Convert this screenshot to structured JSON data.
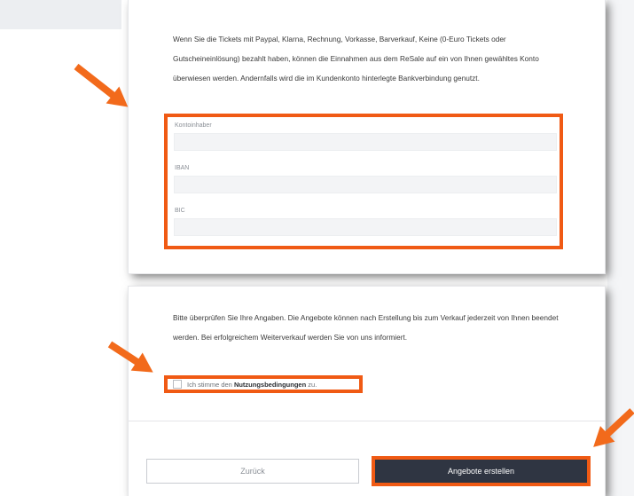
{
  "resale_info": {
    "text": "Wenn Sie die Tickets mit Paypal, Klarna, Rechnung, Vorkasse, Barverkauf, Keine (0-Euro Tickets oder Gutscheineinlösung) bezahlt haben, können die Einnahmen aus dem ReSale auf ein von Ihnen gewähltes Konto überwiesen werden. Andernfalls wird die im Kundenkonto hinterlegte Bankverbindung genutzt."
  },
  "form": {
    "account_holder_label": "Kontoinhaber",
    "account_holder_value": "",
    "iban_label": "IBAN",
    "iban_value": "",
    "bic_label": "BIC",
    "bic_value": ""
  },
  "confirm": {
    "text": "Bitte überprüfen Sie Ihre Angaben. Die Angebote können nach Erstellung bis zum Verkauf jederzeit von Ihnen beendet werden. Bei erfolgreichem Weiterverkauf werden Sie von uns informiert.",
    "checkbox_prefix": "Ich stimme den ",
    "checkbox_link": "Nutzungsbedingungen",
    "checkbox_suffix": " zu.",
    "checked": false
  },
  "buttons": {
    "back": "Zurück",
    "create": "Angebote erstellen"
  },
  "colors": {
    "highlight": "#f05a14",
    "primary_button": "#2f3542"
  }
}
